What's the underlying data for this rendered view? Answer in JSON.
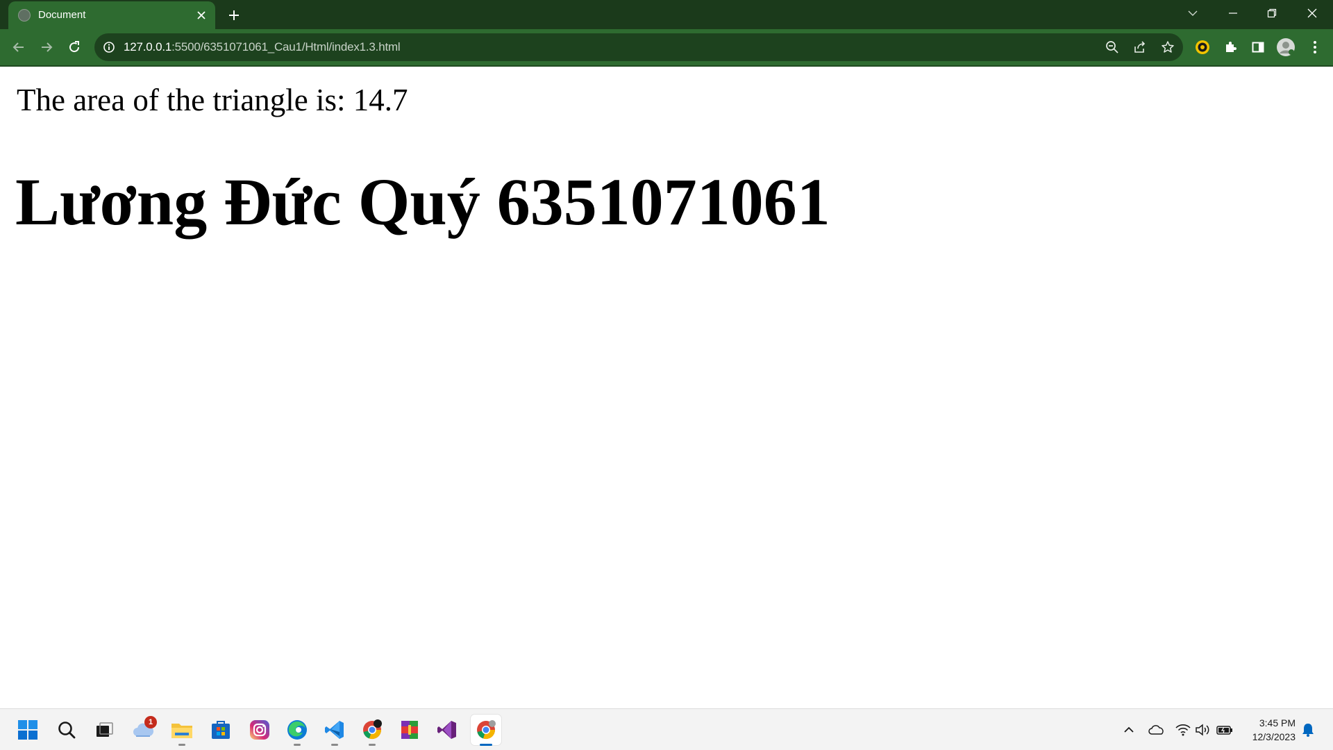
{
  "browser": {
    "tab": {
      "title": "Document",
      "favicon": "globe-icon",
      "close_icon": "close-icon"
    },
    "new_tab_icon": "plus-icon",
    "window_controls": [
      "chevron-down-icon",
      "minimize-icon",
      "restore-icon",
      "close-icon"
    ],
    "toolbar": {
      "back_icon": "arrow-left-icon",
      "forward_icon": "arrow-right-icon",
      "reload_icon": "reload-icon",
      "url_host": "127.0.0.1",
      "url_rest": ":5500/6351071061_Cau1/Html/index1.3.html",
      "omnibox_icons": [
        "zoom-out-icon",
        "share-icon",
        "star-icon"
      ],
      "extension_icons": [
        "extension-badge-icon",
        "puzzle-icon",
        "side-panel-icon",
        "profile-avatar-icon",
        "more-vert-icon"
      ]
    },
    "colors": {
      "frame": "#1b3a1b",
      "toolbar": "#2e6b30",
      "omnibox": "#1d421e"
    }
  },
  "page": {
    "area_text": "The area of the triangle is: 14.7",
    "heading": "Lương Đức Quý 6351071061"
  },
  "taskbar": {
    "apps": [
      {
        "name": "windows-start-icon",
        "running": false
      },
      {
        "name": "search-icon",
        "running": false
      },
      {
        "name": "task-view-icon",
        "running": false
      },
      {
        "name": "weather-widget-icon",
        "running": false,
        "badge": "1"
      },
      {
        "name": "file-explorer-icon",
        "running": true
      },
      {
        "name": "microsoft-store-icon",
        "running": false
      },
      {
        "name": "instagram-icon",
        "running": false
      },
      {
        "name": "edge-icon",
        "running": true
      },
      {
        "name": "vscode-icon",
        "running": true
      },
      {
        "name": "chrome-icon",
        "running": true
      },
      {
        "name": "winrar-icon",
        "running": false
      },
      {
        "name": "visual-studio-icon",
        "running": false
      },
      {
        "name": "chrome-active-icon",
        "running": true,
        "active": true
      }
    ],
    "tray": [
      "chevron-up-icon",
      "onedrive-icon",
      "wifi-icon",
      "volume-icon",
      "battery-icon"
    ],
    "time": "3:45 PM",
    "date": "12/3/2023",
    "notification_icon": "bell-icon"
  }
}
